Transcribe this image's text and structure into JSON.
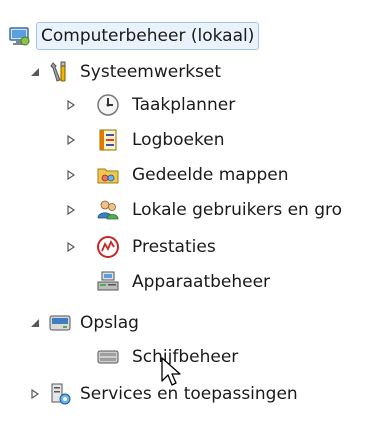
{
  "tree": {
    "root": {
      "label": "Computerbeheer (lokaal)",
      "icon": "computer-management-icon",
      "selected": true
    },
    "items": [
      {
        "label": "Systeemwerkset",
        "icon": "tools-icon",
        "expander": "expanded"
      },
      {
        "label": "Taakplanner",
        "icon": "clock-icon",
        "expander": "collapsed"
      },
      {
        "label": "Logboeken",
        "icon": "event-viewer-icon",
        "expander": "collapsed"
      },
      {
        "label": "Gedeelde mappen",
        "icon": "shared-folders-icon",
        "expander": "collapsed"
      },
      {
        "label": "Lokale gebruikers en gro",
        "icon": "users-icon",
        "expander": "collapsed"
      },
      {
        "label": "Prestaties",
        "icon": "performance-icon",
        "expander": "collapsed"
      },
      {
        "label": "Apparaatbeheer",
        "icon": "device-manager-icon",
        "expander": "none"
      },
      {
        "label": "Opslag",
        "icon": "storage-icon",
        "expander": "expanded"
      },
      {
        "label": "Schijfbeheer",
        "icon": "disk-management-icon",
        "expander": "none"
      },
      {
        "label": "Services en toepassingen",
        "icon": "services-icon",
        "expander": "collapsed"
      }
    ]
  },
  "colors": {
    "selection_background": "#eaf3fc",
    "selection_border": "#9fc6ef",
    "expander": "#595959"
  }
}
